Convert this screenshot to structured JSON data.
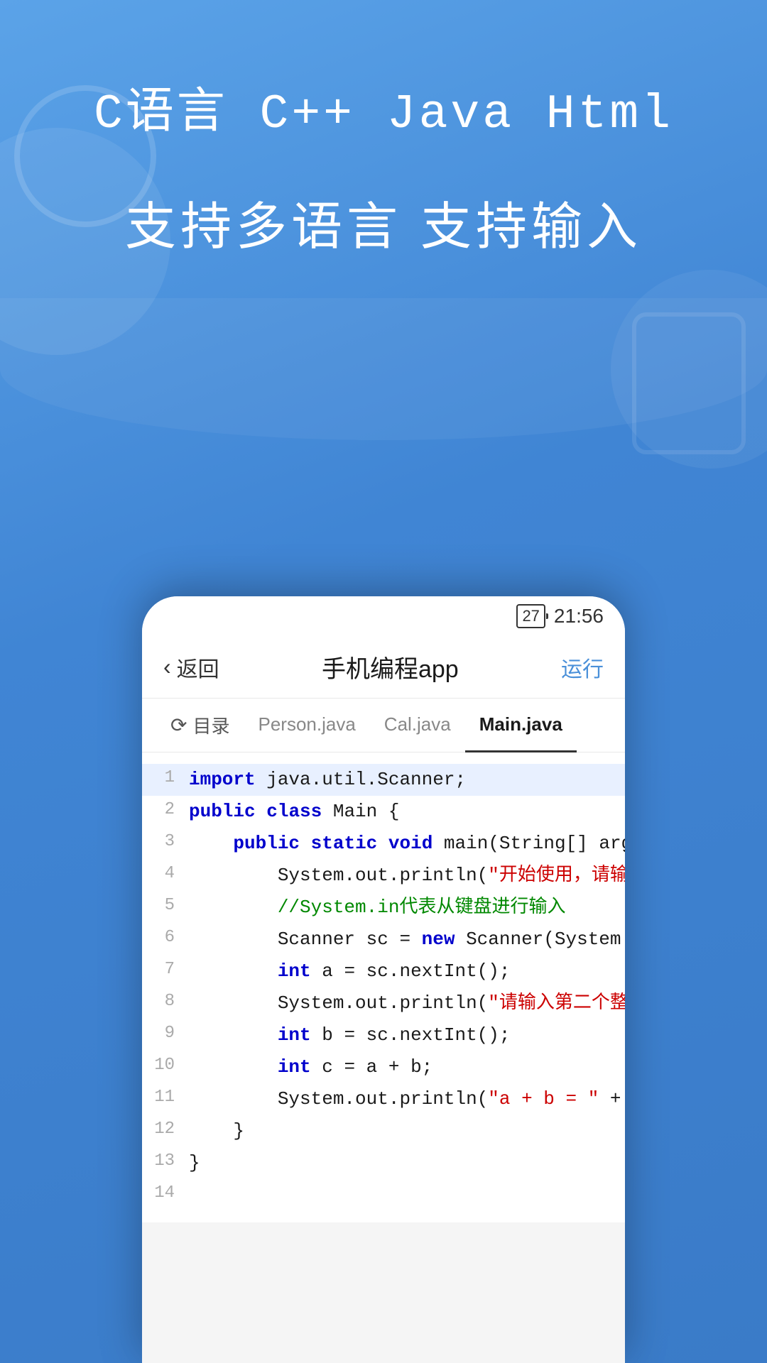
{
  "background": {
    "gradient_start": "#5ba3e8",
    "gradient_end": "#3a7bc8"
  },
  "hero": {
    "languages_line": "C语言  C++  Java  Html",
    "subtitle_line": "支持多语言  支持输入"
  },
  "phone": {
    "status": {
      "battery": "27",
      "time": "21:56"
    },
    "navbar": {
      "back_label": "返回",
      "title": "手机编程app",
      "run_label": "运行"
    },
    "tabs": [
      {
        "label": "目录",
        "id": "directory",
        "active": false
      },
      {
        "label": "Person.java",
        "id": "person",
        "active": false
      },
      {
        "label": "Cal.java",
        "id": "cal",
        "active": false
      },
      {
        "label": "Main.java",
        "id": "main",
        "active": true
      }
    ],
    "code": {
      "filename": "Main.java",
      "lines": [
        {
          "num": "1",
          "text": "import java.util.Scanner;",
          "tokens": [
            {
              "type": "kw-blue",
              "text": "import"
            },
            {
              "type": "normal",
              "text": " java.util.Scanner;"
            }
          ]
        },
        {
          "num": "2",
          "text": "public class Main {",
          "tokens": [
            {
              "type": "kw-blue",
              "text": "public"
            },
            {
              "type": "normal",
              "text": " "
            },
            {
              "type": "kw-blue",
              "text": "class"
            },
            {
              "type": "normal",
              "text": " Main {"
            }
          ]
        },
        {
          "num": "3",
          "text": "    public static void main(String[] args){",
          "tokens": [
            {
              "type": "normal",
              "text": "    "
            },
            {
              "type": "kw-blue",
              "text": "public"
            },
            {
              "type": "normal",
              "text": " "
            },
            {
              "type": "kw-blue",
              "text": "static"
            },
            {
              "type": "normal",
              "text": " "
            },
            {
              "type": "kw-blue",
              "text": "void"
            },
            {
              "type": "normal",
              "text": " main(String[] args){"
            }
          ]
        },
        {
          "num": "4",
          "text": "        System.out.println(\"开始使用，请输入第一个整数吧。\");",
          "tokens": [
            {
              "type": "normal",
              "text": "        System.out.println("
            },
            {
              "type": "str-red",
              "text": "\"开始使用，请输入第一个整数吧。\""
            },
            {
              "type": "normal",
              "text": ");"
            }
          ]
        },
        {
          "num": "5",
          "text": "        //System.in代表从键盘进行输入",
          "tokens": [
            {
              "type": "comment-green",
              "text": "        //System.in代表从键盘进行输入"
            }
          ]
        },
        {
          "num": "6",
          "text": "        Scanner sc = new Scanner(System.in);",
          "tokens": [
            {
              "type": "normal",
              "text": "        Scanner sc = "
            },
            {
              "type": "kw-blue",
              "text": "new"
            },
            {
              "type": "normal",
              "text": " Scanner(System.in);"
            }
          ]
        },
        {
          "num": "7",
          "text": "        int a = sc.nextInt();",
          "tokens": [
            {
              "type": "normal",
              "text": "        "
            },
            {
              "type": "kw-int",
              "text": "int"
            },
            {
              "type": "normal",
              "text": " a = sc.nextInt();"
            }
          ]
        },
        {
          "num": "8",
          "text": "        System.out.println(\"请输入第二个整数吧。\");",
          "tokens": [
            {
              "type": "normal",
              "text": "        System.out.println("
            },
            {
              "type": "str-red",
              "text": "\"请输入第二个整数吧。\""
            },
            {
              "type": "normal",
              "text": ");"
            }
          ]
        },
        {
          "num": "9",
          "text": "        int b = sc.nextInt();",
          "tokens": [
            {
              "type": "normal",
              "text": "        "
            },
            {
              "type": "kw-int",
              "text": "int"
            },
            {
              "type": "normal",
              "text": " b = sc.nextInt();"
            }
          ]
        },
        {
          "num": "10",
          "text": "        int c = a + b;",
          "tokens": [
            {
              "type": "normal",
              "text": "        "
            },
            {
              "type": "kw-int",
              "text": "int"
            },
            {
              "type": "normal",
              "text": " c = a + b;"
            }
          ]
        },
        {
          "num": "11",
          "text": "        System.out.println(\"a + b = \" + c);",
          "tokens": [
            {
              "type": "normal",
              "text": "        System.out.println("
            },
            {
              "type": "str-red",
              "text": "\"a + b = \""
            },
            {
              "type": "normal",
              "text": " + c);"
            }
          ]
        },
        {
          "num": "12",
          "text": "    }",
          "tokens": [
            {
              "type": "normal",
              "text": "    }"
            }
          ]
        },
        {
          "num": "13",
          "text": "}",
          "tokens": [
            {
              "type": "normal",
              "text": "}"
            }
          ]
        },
        {
          "num": "14",
          "text": "",
          "tokens": []
        }
      ]
    }
  }
}
